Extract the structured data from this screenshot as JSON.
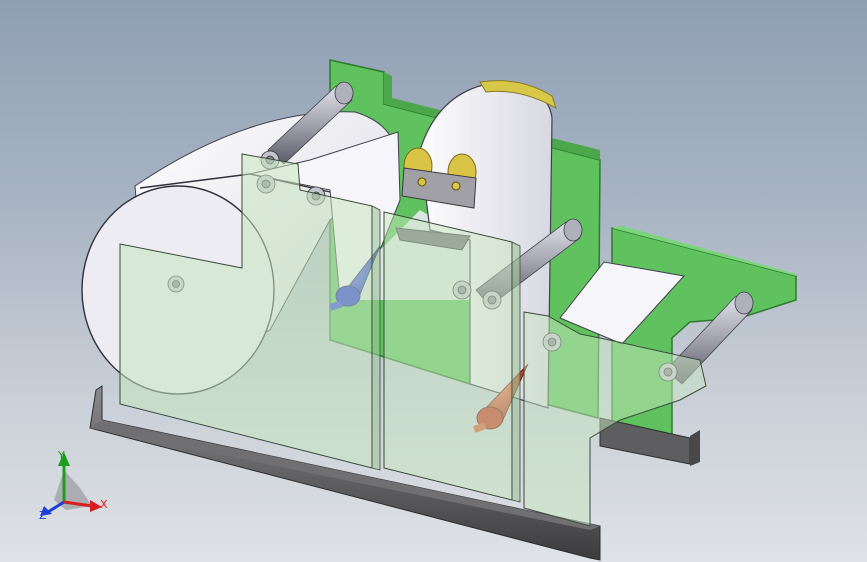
{
  "viewport": {
    "background_top": "#8f9fb3",
    "background_bottom": "#dfe2e6"
  },
  "colors": {
    "frame_plate": "#5fc25f",
    "frame_plate_edge": "#2f7a2f",
    "glass_panel": "#c8e6c0",
    "roll_white": "#f2f2f6",
    "roller_grey": "#9a9aa6",
    "base_rail": "#5e5e60",
    "guide_wheel": "#d9c445",
    "cone_blue": "#1f2fd8",
    "cone_red": "#c8321e"
  },
  "triad": {
    "x_label": "X",
    "y_label": "Y",
    "z_label": "Z"
  }
}
